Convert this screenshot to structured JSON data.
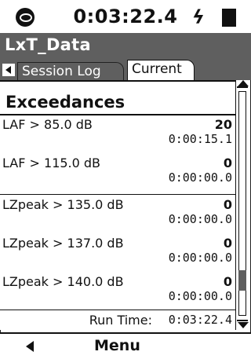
{
  "status_bar": {
    "elapsed_time": "0:03:22.4",
    "icons": [
      "logo-icon",
      "external-power-icon",
      "battery-icon"
    ],
    "power_glyph": "ϟ"
  },
  "title_bar": {
    "title": "LxT_Data"
  },
  "tabs": [
    {
      "label": "Session Log"
    },
    {
      "label": "Current",
      "selected": true
    }
  ],
  "section": {
    "heading": "Exceedances",
    "rows": [
      {
        "label": "LAF > 85.0 dB",
        "count": "20",
        "duration": "0:00:15.1"
      },
      {
        "label": "LAF > 115.0 dB",
        "count": "0",
        "duration": "0:00:00.0"
      },
      {
        "label": "LZpeak > 135.0 dB",
        "count": "0",
        "duration": "0:00:00.0"
      },
      {
        "label": "LZpeak > 137.0 dB",
        "count": "0",
        "duration": "0:00:00.0"
      },
      {
        "label": "LZpeak > 140.0 dB",
        "count": "0",
        "duration": "0:00:00.0"
      }
    ],
    "run_time_label": "Run Time:",
    "run_time_value": "0:03:22.4"
  },
  "softkeys": {
    "back_icon": "triangle-left-icon",
    "menu_label": "Menu"
  },
  "colors": {
    "bar_gray": "#5f5f5f",
    "ink": "#111111",
    "background": "#ffffff"
  }
}
